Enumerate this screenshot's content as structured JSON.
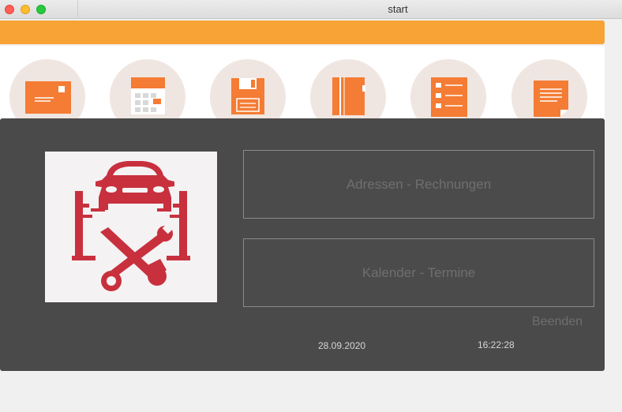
{
  "window": {
    "title": "start"
  },
  "colors": {
    "accent": "#f8a335",
    "icon_orange": "#f47c34",
    "panel": "#4a4a4a",
    "logo_red": "#c8303e"
  },
  "toolbar_icons": [
    {
      "name": "mail-icon"
    },
    {
      "name": "calendar-icon"
    },
    {
      "name": "floppy-disk-icon"
    },
    {
      "name": "notebook-icon"
    },
    {
      "name": "checklist-icon"
    },
    {
      "name": "document-icon"
    }
  ],
  "menu": {
    "addresses_label": "Adressen - Rechnungen",
    "calendar_label": "Kalender - Termine",
    "quit_label": "Beenden"
  },
  "status": {
    "date": "28.09.2020",
    "time": "16:22:28"
  }
}
